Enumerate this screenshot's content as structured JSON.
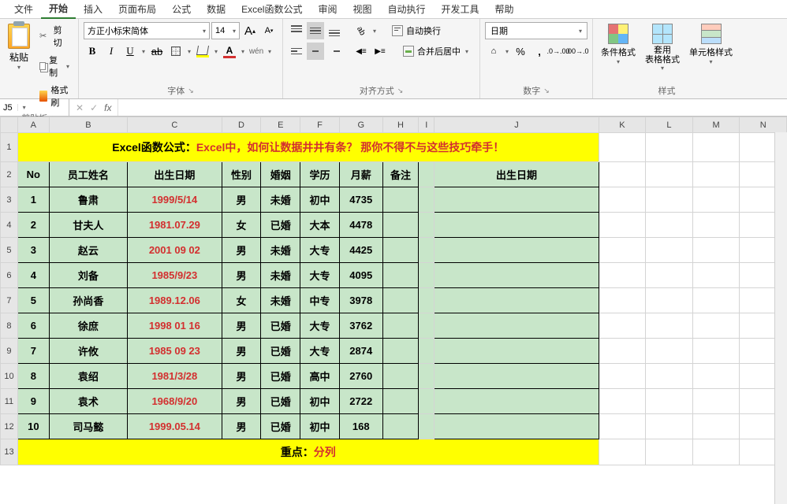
{
  "menu": {
    "items": [
      "文件",
      "开始",
      "插入",
      "页面布局",
      "公式",
      "数据",
      "Excel函数公式",
      "审阅",
      "视图",
      "自动执行",
      "开发工具",
      "帮助"
    ],
    "active_index": 1
  },
  "ribbon": {
    "clipboard": {
      "paste": "粘贴",
      "cut": "剪切",
      "copy": "复制",
      "format_painter": "格式刷",
      "group": "剪贴板"
    },
    "font": {
      "name": "方正小标宋简体",
      "size": "14",
      "group": "字体"
    },
    "align": {
      "wrap": "自动换行",
      "merge": "合并后居中",
      "group": "对齐方式"
    },
    "number": {
      "format": "日期",
      "group": "数字"
    },
    "styles": {
      "cond": "条件格式",
      "table": "套用\n表格格式",
      "cell": "单元格样式",
      "group": "样式"
    }
  },
  "namebox": "J5",
  "columns": [
    "A",
    "B",
    "C",
    "D",
    "E",
    "F",
    "G",
    "H",
    "I",
    "J",
    "K",
    "L",
    "M",
    "N"
  ],
  "sheet": {
    "title": {
      "p1": "Excel函数公式：",
      "p2": "Excel中，如何让数据井井有条？ 那你不得不与这些技巧牵手！"
    },
    "headers": [
      "No",
      "员工姓名",
      "出生日期",
      "性别",
      "婚姻",
      "学历",
      "月薪",
      "备注"
    ],
    "side_header": "出生日期",
    "rows": [
      {
        "no": "1",
        "name": "鲁肃",
        "dob": "1999/5/14",
        "sex": "男",
        "marry": "未婚",
        "edu": "初中",
        "salary": "4735"
      },
      {
        "no": "2",
        "name": "甘夫人",
        "dob": "1981.07.29",
        "sex": "女",
        "marry": "已婚",
        "edu": "大本",
        "salary": "4478"
      },
      {
        "no": "3",
        "name": "赵云",
        "dob": "2001 09 02",
        "sex": "男",
        "marry": "未婚",
        "edu": "大专",
        "salary": "4425"
      },
      {
        "no": "4",
        "name": "刘备",
        "dob": "1985/9/23",
        "sex": "男",
        "marry": "未婚",
        "edu": "大专",
        "salary": "4095"
      },
      {
        "no": "5",
        "name": "孙尚香",
        "dob": "1989.12.06",
        "sex": "女",
        "marry": "未婚",
        "edu": "中专",
        "salary": "3978"
      },
      {
        "no": "6",
        "name": "徐庶",
        "dob": "1998 01 16",
        "sex": "男",
        "marry": "已婚",
        "edu": "大专",
        "salary": "3762"
      },
      {
        "no": "7",
        "name": "许攸",
        "dob": "1985 09 23",
        "sex": "男",
        "marry": "已婚",
        "edu": "大专",
        "salary": "2874"
      },
      {
        "no": "8",
        "name": "袁绍",
        "dob": "1981/3/28",
        "sex": "男",
        "marry": "已婚",
        "edu": "高中",
        "salary": "2760"
      },
      {
        "no": "9",
        "name": "袁术",
        "dob": "1968/9/20",
        "sex": "男",
        "marry": "已婚",
        "edu": "初中",
        "salary": "2722"
      },
      {
        "no": "10",
        "name": "司马懿",
        "dob": "1999.05.14",
        "sex": "男",
        "marry": "已婚",
        "edu": "初中",
        "salary": "168"
      }
    ],
    "footer": {
      "p1": "重点：",
      "p2": "分列"
    },
    "last_row_num": "13"
  }
}
